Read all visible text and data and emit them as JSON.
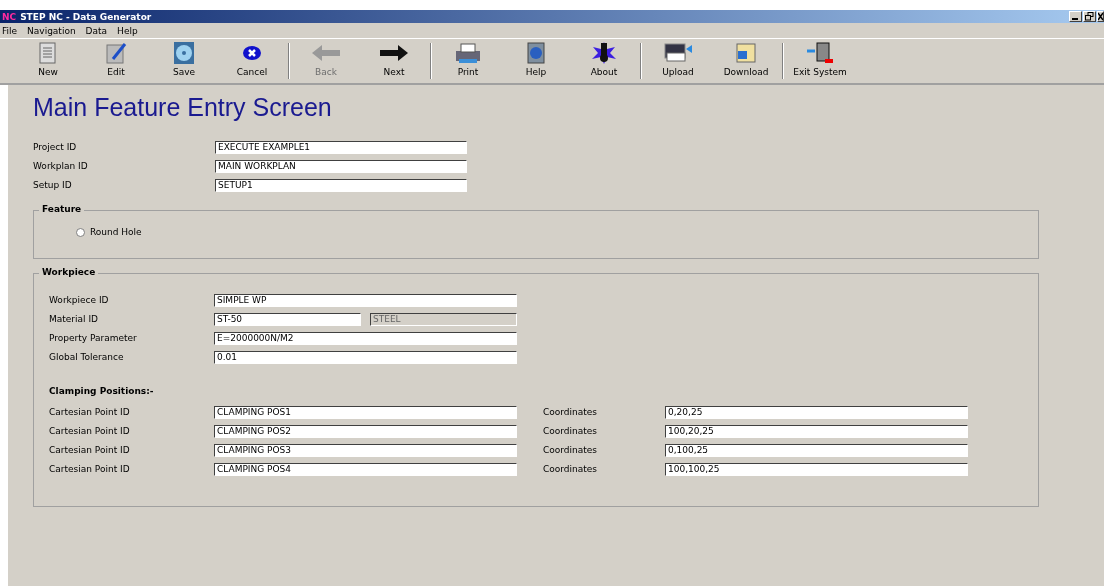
{
  "window": {
    "title": "STEP NC - Data Generator",
    "logo": "NC"
  },
  "menu": [
    "File",
    "Navigation",
    "Data",
    "Help"
  ],
  "toolbar": [
    [
      {
        "label": "New",
        "disabled": false
      },
      {
        "label": "Edit",
        "disabled": false
      },
      {
        "label": "Save",
        "disabled": false
      },
      {
        "label": "Cancel",
        "disabled": false
      }
    ],
    [
      {
        "label": "Back",
        "disabled": true
      },
      {
        "label": "Next",
        "disabled": false
      }
    ],
    [
      {
        "label": "Print",
        "disabled": false
      },
      {
        "label": "Help",
        "disabled": false
      },
      {
        "label": "About",
        "disabled": false
      }
    ],
    [
      {
        "label": "Upload",
        "disabled": false
      },
      {
        "label": "Download",
        "disabled": false
      }
    ],
    [
      {
        "label": "Exit System",
        "disabled": false
      }
    ]
  ],
  "heading": "Main Feature Entry Screen",
  "project_fields": [
    {
      "label": "Project ID",
      "value": "EXECUTE EXAMPLE1"
    },
    {
      "label": "Workplan ID",
      "value": "MAIN WORKPLAN"
    },
    {
      "label": "Setup ID",
      "value": "SETUP1"
    }
  ],
  "feature": {
    "title": "Feature",
    "options": [
      {
        "label": "Round Hole",
        "selected": false
      }
    ]
  },
  "workpiece": {
    "title": "Workpiece",
    "fields": [
      {
        "label": "Workpiece ID",
        "value": "SIMPLE WP"
      },
      {
        "label": "Material ID",
        "value": "ST-50",
        "extra": {
          "value": "STEEL",
          "disabled": true
        }
      },
      {
        "label": "Property Parameter",
        "value": "E=2000000N/M2"
      },
      {
        "label": "Global Tolerance",
        "value": "0.01"
      }
    ],
    "clamping_title": "Clamping Positions:-",
    "clamping": [
      {
        "label": "Cartesian Point ID",
        "value": "CLAMPING POS1",
        "coord_label": "Coordinates",
        "coord_value": "0,20,25"
      },
      {
        "label": "Cartesian Point ID",
        "value": "CLAMPING POS2",
        "coord_label": "Coordinates",
        "coord_value": "100,20,25"
      },
      {
        "label": "Cartesian Point ID",
        "value": "CLAMPING POS3",
        "coord_label": "Coordinates",
        "coord_value": "0,100,25"
      },
      {
        "label": "Cartesian Point ID",
        "value": "CLAMPING POS4",
        "coord_label": "Coordinates",
        "coord_value": "100,100,25"
      }
    ]
  }
}
